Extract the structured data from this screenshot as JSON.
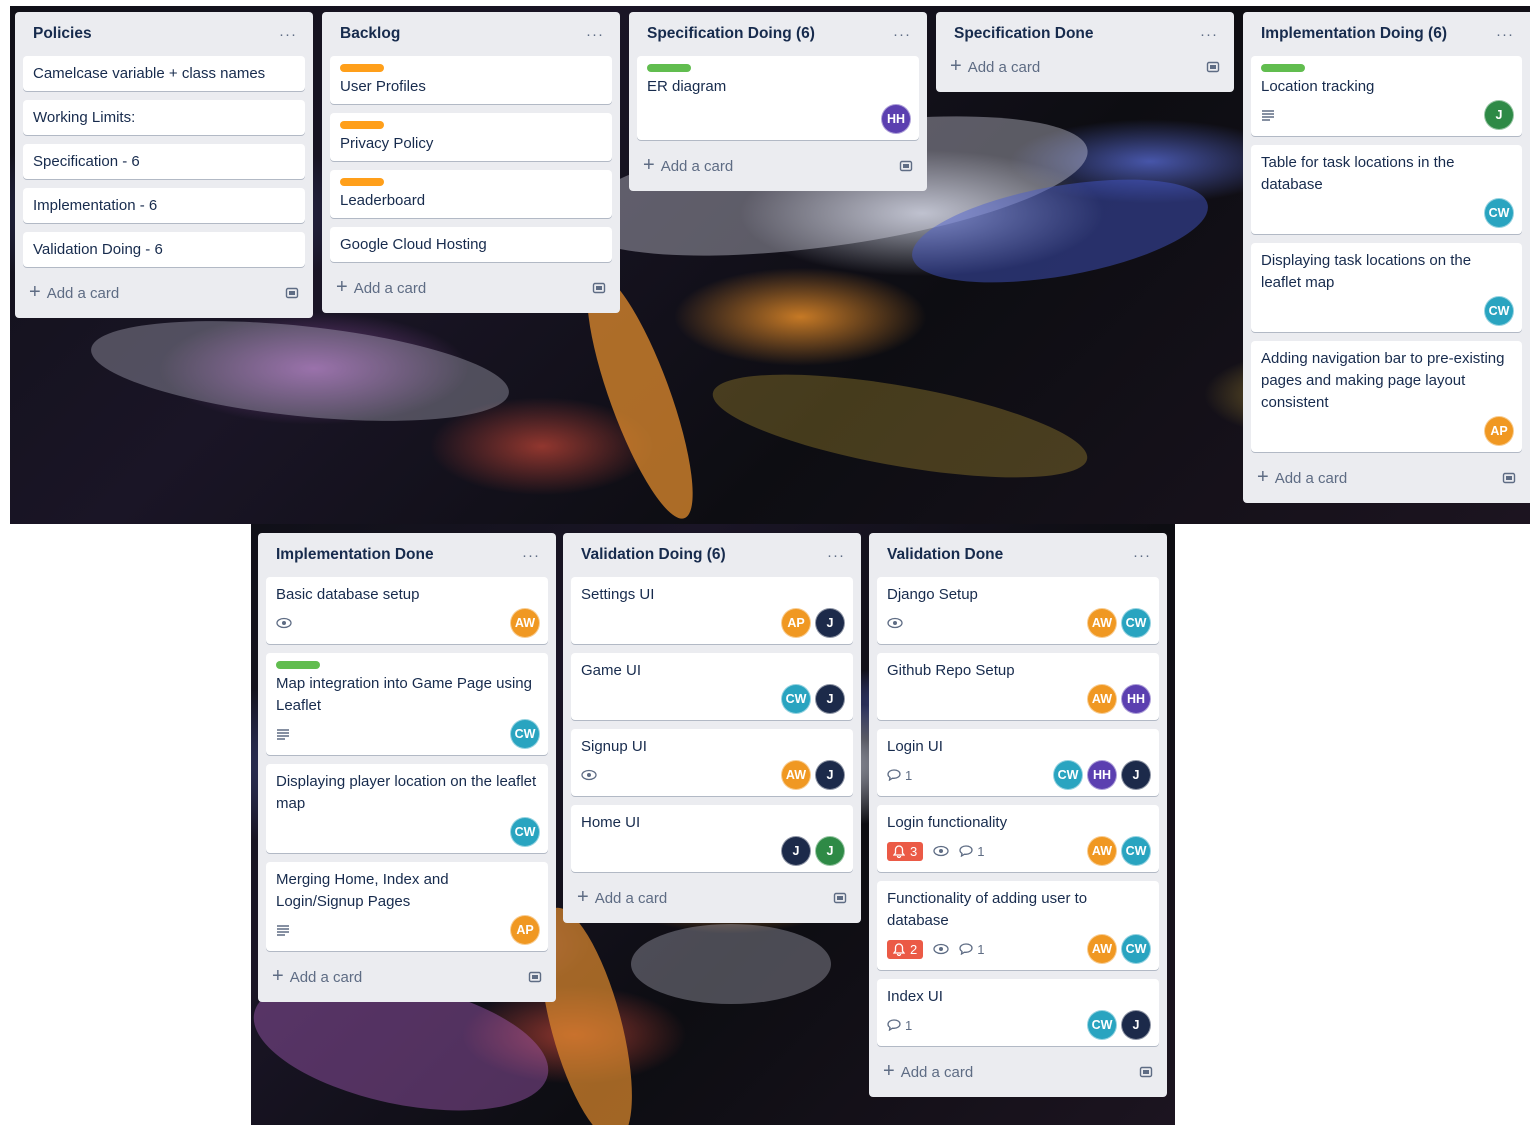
{
  "colors": {
    "AW": "#f09822",
    "AP": "#f09822",
    "CW": "#29a4c0",
    "HH": "#5b3fb0",
    "J_dark": "#1c2a4a",
    "J_green": "#2e8a46"
  },
  "lists": [
    {
      "title": "Policies",
      "menu": "···",
      "cards": [
        {
          "title": "Camelcase variable + class names"
        },
        {
          "title": "Working Limits:"
        },
        {
          "title": "Specification - 6"
        },
        {
          "title": "Implementation - 6"
        },
        {
          "title": "Validation Doing - 6"
        }
      ],
      "add_label": "Add a card"
    },
    {
      "title": "Backlog",
      "menu": "···",
      "cards": [
        {
          "title": "User Profiles",
          "label": "orange"
        },
        {
          "title": "Privacy Policy",
          "label": "orange"
        },
        {
          "title": "Leaderboard",
          "label": "orange"
        },
        {
          "title": "Google Cloud Hosting"
        }
      ],
      "add_label": "Add a card"
    },
    {
      "title": "Specification Doing (6)",
      "menu": "···",
      "cards": [
        {
          "title": "ER diagram",
          "label": "green",
          "members": [
            "HH"
          ]
        }
      ],
      "add_label": "Add a card"
    },
    {
      "title": "Specification Done",
      "menu": "···",
      "cards": [],
      "add_label": "Add a card"
    },
    {
      "title": "Implementation Doing (6)",
      "menu": "···",
      "cards": [
        {
          "title": "Location tracking",
          "label": "green",
          "description": true,
          "members": [
            "J"
          ],
          "member_color": "J_green"
        },
        {
          "title": "Table for task locations in the database",
          "members": [
            "CW"
          ]
        },
        {
          "title": "Displaying task locations on the leaflet map",
          "members": [
            "CW"
          ]
        },
        {
          "title": "Adding navigation bar to pre-existing pages and making page layout consistent",
          "members": [
            "AP"
          ]
        }
      ],
      "add_label": "Add a card"
    },
    {
      "title": "Implementation Done",
      "menu": "···",
      "cards": [
        {
          "title": "Basic database setup",
          "watch": true,
          "members": [
            "AW"
          ]
        },
        {
          "title": "Map integration into Game Page using Leaflet",
          "label": "green",
          "description": true,
          "members": [
            "CW"
          ]
        },
        {
          "title": "Displaying player location on the leaflet map",
          "members": [
            "CW"
          ]
        },
        {
          "title": "Merging Home, Index and Login/Signup Pages",
          "description": true,
          "members": [
            "AP"
          ]
        }
      ],
      "add_label": "Add a card"
    },
    {
      "title": "Validation Doing (6)",
      "menu": "···",
      "cards": [
        {
          "title": "Settings UI",
          "members": [
            "AP",
            "J"
          ]
        },
        {
          "title": "Game UI",
          "members": [
            "CW",
            "J"
          ]
        },
        {
          "title": "Signup UI",
          "watch": true,
          "members": [
            "AW",
            "J"
          ]
        },
        {
          "title": "Home UI",
          "members": [
            "J",
            "J"
          ],
          "member_colors": [
            "J_dark",
            "J_green"
          ]
        }
      ],
      "add_label": "Add a card"
    },
    {
      "title": "Validation Done",
      "menu": "···",
      "cards": [
        {
          "title": "Django Setup",
          "watch": true,
          "members": [
            "AW",
            "CW"
          ]
        },
        {
          "title": "Github Repo Setup",
          "members": [
            "AW",
            "HH"
          ]
        },
        {
          "title": "Login UI",
          "comments": "1",
          "members": [
            "CW",
            "HH",
            "J"
          ]
        },
        {
          "title": "Login functionality",
          "alert": "3",
          "watch": true,
          "comments": "1",
          "members": [
            "AW",
            "CW"
          ]
        },
        {
          "title": "Functionality of adding user to database",
          "alert": "2",
          "watch": true,
          "comments": "1",
          "members": [
            "AW",
            "CW"
          ]
        },
        {
          "title": "Index UI",
          "comments": "1",
          "members": [
            "CW",
            "J"
          ]
        }
      ],
      "add_label": "Add a card"
    }
  ]
}
